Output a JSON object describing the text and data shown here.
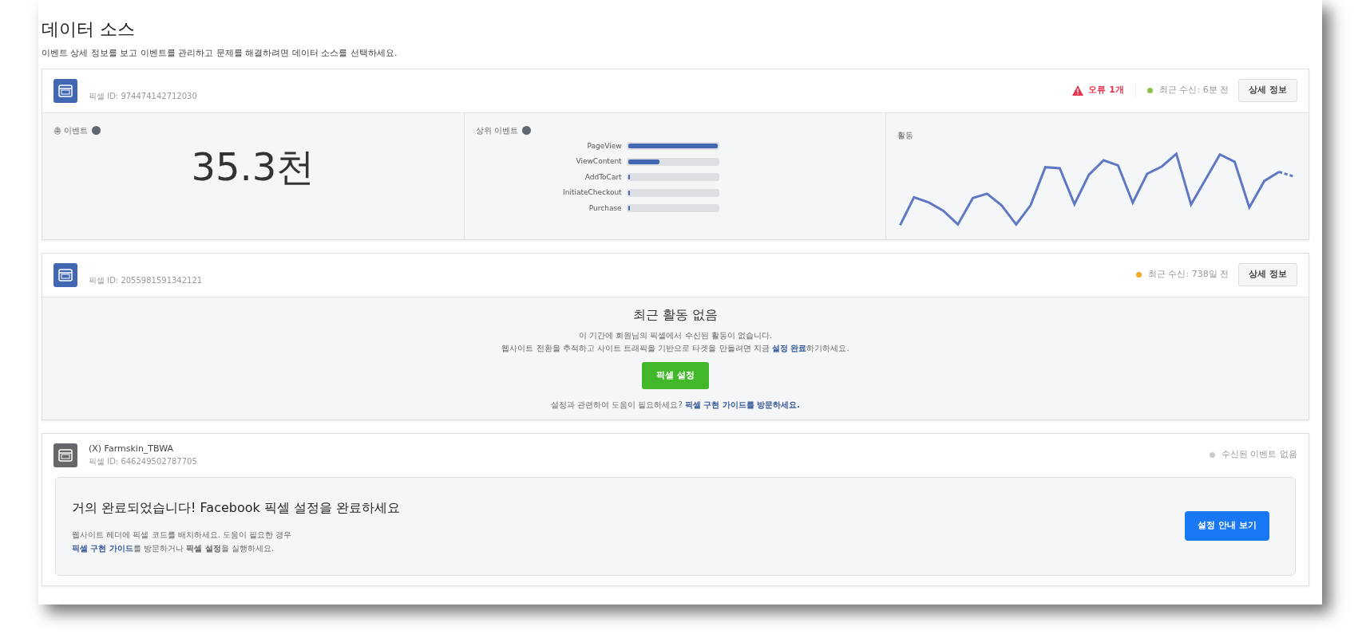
{
  "header": {
    "title": "데이터 소스",
    "subtitle": "이벤트 상세 정보를 보고 이벤트를 관리하고 문제를 해결하려면 데이터 소스를 선택하세요."
  },
  "sources": [
    {
      "kind": "stats",
      "pixel_id": "픽셀 ID: 974474142712030",
      "error": "오류 1개",
      "status": "최근 수신: 6분 전",
      "color": "#8bc34a",
      "details_button": "상세 정보",
      "total": {
        "label": "총 이벤트",
        "value": "35.3천"
      },
      "top_events": {
        "label": "상위 이벤트",
        "events": [
          {
            "name": "PageView",
            "level": 1.0
          },
          {
            "name": "ViewContent",
            "level": 0.35
          },
          {
            "name": "AddToCart",
            "level": 0.01
          },
          {
            "name": "InitiateCheckout",
            "level": 0.01
          },
          {
            "name": "Purchase",
            "level": 0.01
          }
        ]
      },
      "activity": {
        "label": "활동"
      }
    },
    {
      "kind": "no_activity",
      "pixel_id": "픽셀 ID: 2055981591342121",
      "status": "최근 수신: 738일 전",
      "color": "#f5a623",
      "details_button": "상세 정보",
      "heading": "최근 활동 없음",
      "line_1": "이 기간에 회원님의 픽셀에서 수신된 활동이 없습니다.",
      "line_2_before": "웹사이트 전환을 추적하고 사이트 트래픽을 기반으로 타겟을 만들려면 지금",
      "line_2_link": "설정 완료",
      "line_2_after": "하기하세요.",
      "setup_button": "픽셀 설정",
      "help_before": "설정과 관련하여 도움이 필요하세요?",
      "help_link": "픽셀 구현 가이드를 방문하세요."
    },
    {
      "kind": "setup",
      "name": "(X) Farmskin_TBWA",
      "pixel_id": "픽셀 ID: 646249502787705",
      "status": "수신된 이벤트 없음",
      "color": "#cccccc",
      "heading": "거의 완료되었습니다! Facebook 픽셀 설정을 완료하세요",
      "line_1": "웹사이트 헤더에 픽셀 코드를 배치하세요. 도움이 필요한 경우",
      "line_2_link": "픽셀 구현 가이드",
      "line_2_after": "를 방문하거나 **픽셀 설정**을 실행하세요.",
      "guide_button": "설정 안내 보기"
    }
  ]
}
